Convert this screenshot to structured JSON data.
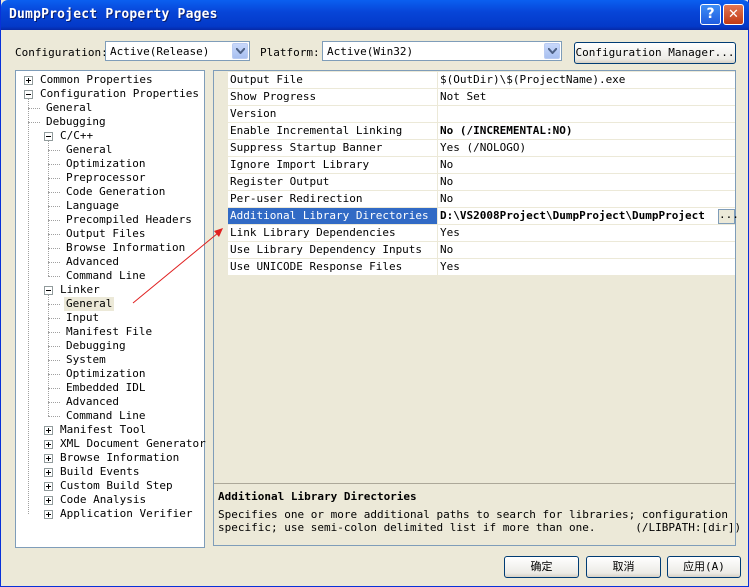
{
  "window": {
    "title": "DumpProject Property Pages"
  },
  "toolbar": {
    "configuration_label": "Configuration:",
    "configuration_value": "Active(Release)",
    "platform_label": "Platform:",
    "platform_value": "Active(Win32)",
    "config_manager_label": "Configuration Manager..."
  },
  "tree": {
    "items": [
      {
        "label": "Common Properties",
        "level": 0,
        "expander": "plus"
      },
      {
        "label": "Configuration Properties",
        "level": 0,
        "expander": "minus"
      },
      {
        "label": "General",
        "level": 1
      },
      {
        "label": "Debugging",
        "level": 1
      },
      {
        "label": "C/C++",
        "level": 1,
        "expander": "minus"
      },
      {
        "label": "General",
        "level": 2
      },
      {
        "label": "Optimization",
        "level": 2
      },
      {
        "label": "Preprocessor",
        "level": 2
      },
      {
        "label": "Code Generation",
        "level": 2
      },
      {
        "label": "Language",
        "level": 2
      },
      {
        "label": "Precompiled Headers",
        "level": 2
      },
      {
        "label": "Output Files",
        "level": 2
      },
      {
        "label": "Browse Information",
        "level": 2
      },
      {
        "label": "Advanced",
        "level": 2
      },
      {
        "label": "Command Line",
        "level": 2
      },
      {
        "label": "Linker",
        "level": 1,
        "expander": "minus"
      },
      {
        "label": "General",
        "level": 2,
        "selected": true
      },
      {
        "label": "Input",
        "level": 2
      },
      {
        "label": "Manifest File",
        "level": 2
      },
      {
        "label": "Debugging",
        "level": 2
      },
      {
        "label": "System",
        "level": 2
      },
      {
        "label": "Optimization",
        "level": 2
      },
      {
        "label": "Embedded IDL",
        "level": 2
      },
      {
        "label": "Advanced",
        "level": 2
      },
      {
        "label": "Command Line",
        "level": 2
      },
      {
        "label": "Manifest Tool",
        "level": 1,
        "expander": "plus"
      },
      {
        "label": "XML Document Generator",
        "level": 1,
        "expander": "plus"
      },
      {
        "label": "Browse Information",
        "level": 1,
        "expander": "plus"
      },
      {
        "label": "Build Events",
        "level": 1,
        "expander": "plus"
      },
      {
        "label": "Custom Build Step",
        "level": 1,
        "expander": "plus"
      },
      {
        "label": "Code Analysis",
        "level": 1,
        "expander": "plus"
      },
      {
        "label": "Application Verifier",
        "level": 1,
        "expander": "plus"
      }
    ]
  },
  "properties": {
    "rows": [
      {
        "name": "Output File",
        "value": "$(OutDir)\\$(ProjectName).exe"
      },
      {
        "name": "Show Progress",
        "value": "Not Set"
      },
      {
        "name": "Version",
        "value": ""
      },
      {
        "name": "Enable Incremental Linking",
        "value": "No (/INCREMENTAL:NO)",
        "bold": true
      },
      {
        "name": "Suppress Startup Banner",
        "value": "Yes (/NOLOGO)"
      },
      {
        "name": "Ignore Import Library",
        "value": "No"
      },
      {
        "name": "Register Output",
        "value": "No"
      },
      {
        "name": "Per-user Redirection",
        "value": "No"
      },
      {
        "name": "Additional Library Directories",
        "value": "D:\\VS2008Project\\DumpProject\\DumpProject",
        "bold": true,
        "selected": true
      },
      {
        "name": "Link Library Dependencies",
        "value": "Yes"
      },
      {
        "name": "Use Library Dependency Inputs",
        "value": "No"
      },
      {
        "name": "Use UNICODE Response Files",
        "value": "Yes"
      }
    ],
    "ellipsis": "..."
  },
  "description": {
    "title": "Additional Library Directories",
    "text": "Specifies one or more additional paths to search for libraries; configuration\nspecific; use semi-colon delimited list if more than one.      (/LIBPATH:[dir])"
  },
  "buttons": {
    "ok": "确定",
    "cancel": "取消",
    "apply": "应用(A)"
  },
  "colors": {
    "selection": "#316AC5",
    "annotation_arrow": "#E02020"
  },
  "icons": [
    "help-icon",
    "close-icon",
    "dropdown-arrow-icon",
    "expand-icon",
    "collapse-icon",
    "annotation-arrow-icon"
  ]
}
